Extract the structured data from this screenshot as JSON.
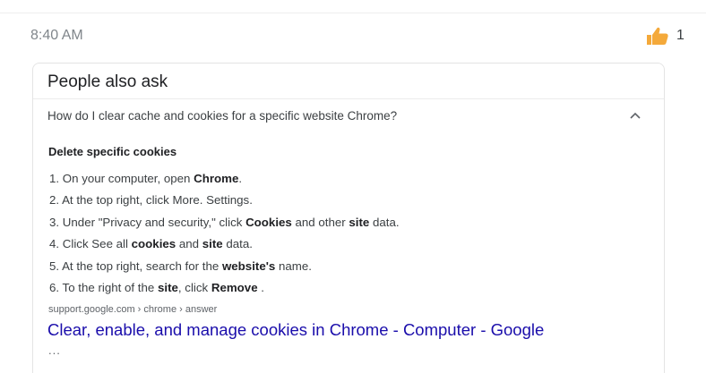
{
  "message": {
    "timestamp": "8:40 AM",
    "reaction": {
      "icon": "thumbs-up-icon",
      "count": "1",
      "color": "#f4a93a"
    }
  },
  "card": {
    "section_title": "People also ask",
    "question": "How do I clear cache and cookies for a specific website Chrome?",
    "answer_heading": "Delete specific cookies",
    "steps": [
      {
        "num": "1.",
        "parts": [
          {
            "t": "On your computer, open "
          },
          {
            "t": "Chrome",
            "b": true
          },
          {
            "t": "."
          }
        ]
      },
      {
        "num": "2.",
        "parts": [
          {
            "t": "At the top right, click More. Settings."
          }
        ]
      },
      {
        "num": "3.",
        "parts": [
          {
            "t": "Under \"Privacy and security,\" click "
          },
          {
            "t": "Cookies",
            "b": true
          },
          {
            "t": " and other "
          },
          {
            "t": "site",
            "b": true
          },
          {
            "t": " data."
          }
        ]
      },
      {
        "num": "4.",
        "parts": [
          {
            "t": "Click See all "
          },
          {
            "t": "cookies",
            "b": true
          },
          {
            "t": " and "
          },
          {
            "t": "site",
            "b": true
          },
          {
            "t": " data."
          }
        ]
      },
      {
        "num": "5.",
        "parts": [
          {
            "t": "At the top right, search for the "
          },
          {
            "t": "website's",
            "b": true
          },
          {
            "t": " name."
          }
        ]
      },
      {
        "num": "6.",
        "parts": [
          {
            "t": "To the right of the "
          },
          {
            "t": "site",
            "b": true
          },
          {
            "t": ", click "
          },
          {
            "t": "Remove",
            "b": true
          },
          {
            "t": " ."
          }
        ]
      }
    ],
    "source": "support.google.com › chrome › answer",
    "link_text": "Clear, enable, and manage cookies in Chrome - Computer - Google",
    "more": "..."
  }
}
